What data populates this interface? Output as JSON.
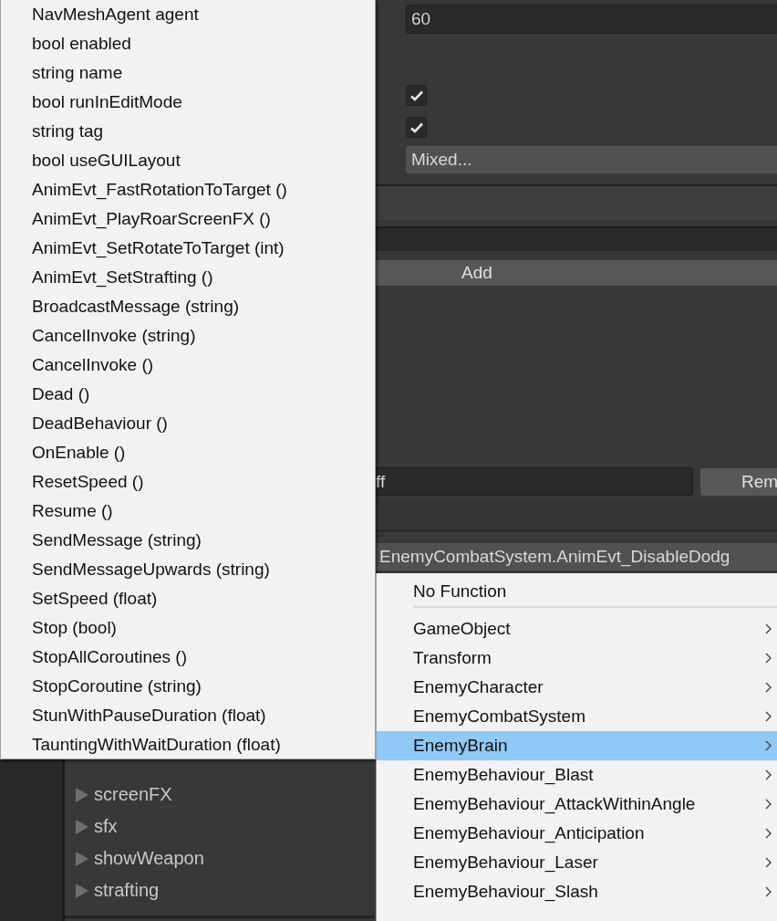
{
  "inspector": {
    "number_field": {
      "value": "60"
    },
    "checkboxes": [
      {
        "checked": true
      },
      {
        "checked": true
      }
    ],
    "mixed_dropdown": {
      "value": "Mixed..."
    },
    "add_button": {
      "label": "Add"
    },
    "name_field": {
      "value": "ff"
    },
    "remove_button": {
      "label": "Rem"
    },
    "function_dropdown": {
      "value": "EnemyCombatSystem.AnimEvt_DisableDodg"
    }
  },
  "tree": {
    "items": [
      {
        "label": "screenFX"
      },
      {
        "label": "sfx"
      },
      {
        "label": "showWeapon"
      },
      {
        "label": "strafting"
      }
    ]
  },
  "member_menu": {
    "items": [
      {
        "label": "NavMeshAgent agent"
      },
      {
        "label": "bool enabled"
      },
      {
        "label": "string name"
      },
      {
        "label": "bool runInEditMode"
      },
      {
        "label": "string tag"
      },
      {
        "label": "bool useGUILayout"
      },
      {
        "label": "AnimEvt_FastRotationToTarget ()"
      },
      {
        "label": "AnimEvt_PlayRoarScreenFX ()"
      },
      {
        "label": "AnimEvt_SetRotateToTarget (int)"
      },
      {
        "label": "AnimEvt_SetStrafting ()"
      },
      {
        "label": "BroadcastMessage (string)"
      },
      {
        "label": "CancelInvoke (string)"
      },
      {
        "label": "CancelInvoke ()"
      },
      {
        "label": "Dead ()"
      },
      {
        "label": "DeadBehaviour ()"
      },
      {
        "label": "OnEnable ()"
      },
      {
        "label": "ResetSpeed ()"
      },
      {
        "label": "Resume ()"
      },
      {
        "label": "SendMessage (string)"
      },
      {
        "label": "SendMessageUpwards (string)"
      },
      {
        "label": "SetSpeed (float)"
      },
      {
        "label": "Stop (bool)"
      },
      {
        "label": "StopAllCoroutines ()"
      },
      {
        "label": "StopCoroutine (string)"
      },
      {
        "label": "StunWithPauseDuration (float)"
      },
      {
        "label": "TauntingWithWaitDuration (float)"
      }
    ]
  },
  "component_menu": {
    "groups": [
      [
        {
          "label": "No Function",
          "kind": "plain",
          "selected": false
        }
      ],
      [
        {
          "label": "GameObject",
          "kind": "submenu",
          "selected": false
        },
        {
          "label": "Transform",
          "kind": "submenu",
          "selected": false
        },
        {
          "label": "EnemyCharacter",
          "kind": "submenu",
          "selected": false
        },
        {
          "label": "EnemyCombatSystem",
          "kind": "submenu",
          "selected": false
        },
        {
          "label": "EnemyBrain",
          "kind": "submenu",
          "selected": true
        },
        {
          "label": "EnemyBehaviour_Blast",
          "kind": "submenu",
          "selected": false
        },
        {
          "label": "EnemyBehaviour_AttackWithinAngle",
          "kind": "submenu",
          "selected": false
        },
        {
          "label": "EnemyBehaviour_Anticipation",
          "kind": "submenu",
          "selected": false
        },
        {
          "label": "EnemyBehaviour_Laser",
          "kind": "submenu",
          "selected": false
        },
        {
          "label": "EnemyBehaviour_Slash",
          "kind": "submenu",
          "selected": false
        }
      ]
    ]
  }
}
